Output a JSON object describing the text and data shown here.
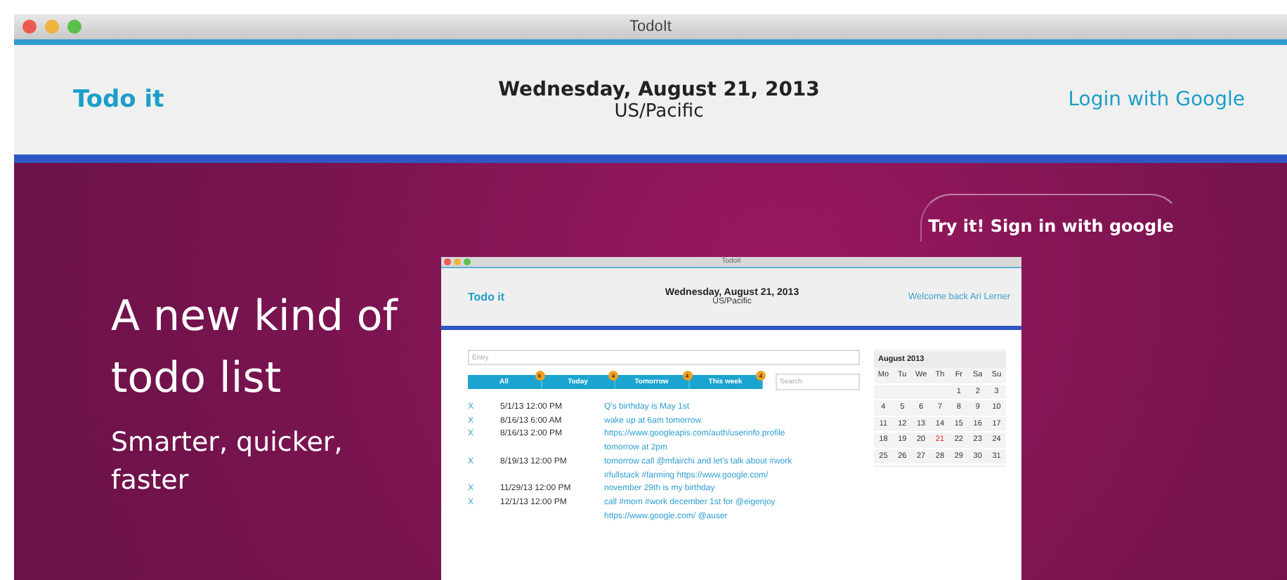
{
  "window": {
    "title": "TodoIt"
  },
  "header": {
    "logo": "Todo it",
    "date": "Wednesday, August 21, 2013",
    "timezone": "US/Pacific",
    "login": "Login with Google"
  },
  "hero": {
    "headline": "A new kind of todo list",
    "subline": "Smarter, quicker, faster",
    "signin": "Try it! Sign in with google"
  },
  "preview": {
    "window": {
      "title": "TodoIt"
    },
    "header": {
      "logo": "Todo it",
      "date": "Wednesday, August 21, 2013",
      "timezone": "US/Pacific",
      "welcome": "Welcome back Ari Lerner"
    },
    "entry": {
      "placeholder": "Entry"
    },
    "tabs": [
      {
        "label": "All",
        "count": "6"
      },
      {
        "label": "Today",
        "count": "4"
      },
      {
        "label": "Tomorrow",
        "count": "4"
      },
      {
        "label": "This week",
        "count": "4"
      }
    ],
    "search": {
      "placeholder": "Search"
    },
    "todos": [
      {
        "remove": "X",
        "when": "5/1/13 12:00 PM",
        "text": "Q's birthday is May 1st"
      },
      {
        "remove": "X",
        "when": "8/16/13 6:00 AM",
        "text": "wake up at 6am tomorrow"
      },
      {
        "remove": "X",
        "when": "8/16/13 2:00 PM",
        "text": "https://www.googleapis.com/auth/userinfo.profile tomorrow at 2pm"
      },
      {
        "remove": "X",
        "when": "8/19/13 12:00 PM",
        "text": "tomorrow call @mfairchi and let's talk about #work #fullstack #farming https://www.google.com/"
      },
      {
        "remove": "X",
        "when": "11/29/13 12:00 PM",
        "text": "november 29th is my birthday"
      },
      {
        "remove": "X",
        "when": "12/1/13 12:00 PM",
        "text": "call #mom #work december 1st for @eigenjoy https://www.google.com/ @auser"
      }
    ],
    "calendar": {
      "title": "August 2013",
      "weekdays": [
        "Mo",
        "Tu",
        "We",
        "Th",
        "Fr",
        "Sa",
        "Su"
      ],
      "weeks": [
        [
          {
            "day": "1",
            "selected": false
          },
          {
            "day": "2",
            "selected": false
          },
          {
            "day": "3",
            "selected": false
          }
        ],
        [
          {
            "day": "4",
            "selected": false
          },
          {
            "day": "5",
            "selected": false
          },
          {
            "day": "6",
            "selected": false
          },
          {
            "day": "7",
            "selected": false
          },
          {
            "day": "8",
            "selected": false
          },
          {
            "day": "9",
            "selected": false
          },
          {
            "day": "10",
            "selected": false
          }
        ],
        [
          {
            "day": "11",
            "selected": false
          },
          {
            "day": "12",
            "selected": false
          },
          {
            "day": "13",
            "selected": false
          },
          {
            "day": "14",
            "selected": false
          },
          {
            "day": "15",
            "selected": false
          },
          {
            "day": "16",
            "selected": false
          },
          {
            "day": "17",
            "selected": false
          }
        ],
        [
          {
            "day": "18",
            "selected": false
          },
          {
            "day": "19",
            "selected": false
          },
          {
            "day": "20",
            "selected": false
          },
          {
            "day": "21",
            "selected": true
          },
          {
            "day": "22",
            "selected": false
          },
          {
            "day": "23",
            "selected": false
          },
          {
            "day": "24",
            "selected": false
          }
        ],
        [
          {
            "day": "25",
            "selected": false
          },
          {
            "day": "26",
            "selected": false
          },
          {
            "day": "27",
            "selected": false
          },
          {
            "day": "28",
            "selected": false
          },
          {
            "day": "29",
            "selected": false
          },
          {
            "day": "30",
            "selected": false
          },
          {
            "day": "31",
            "selected": false
          }
        ]
      ]
    }
  }
}
